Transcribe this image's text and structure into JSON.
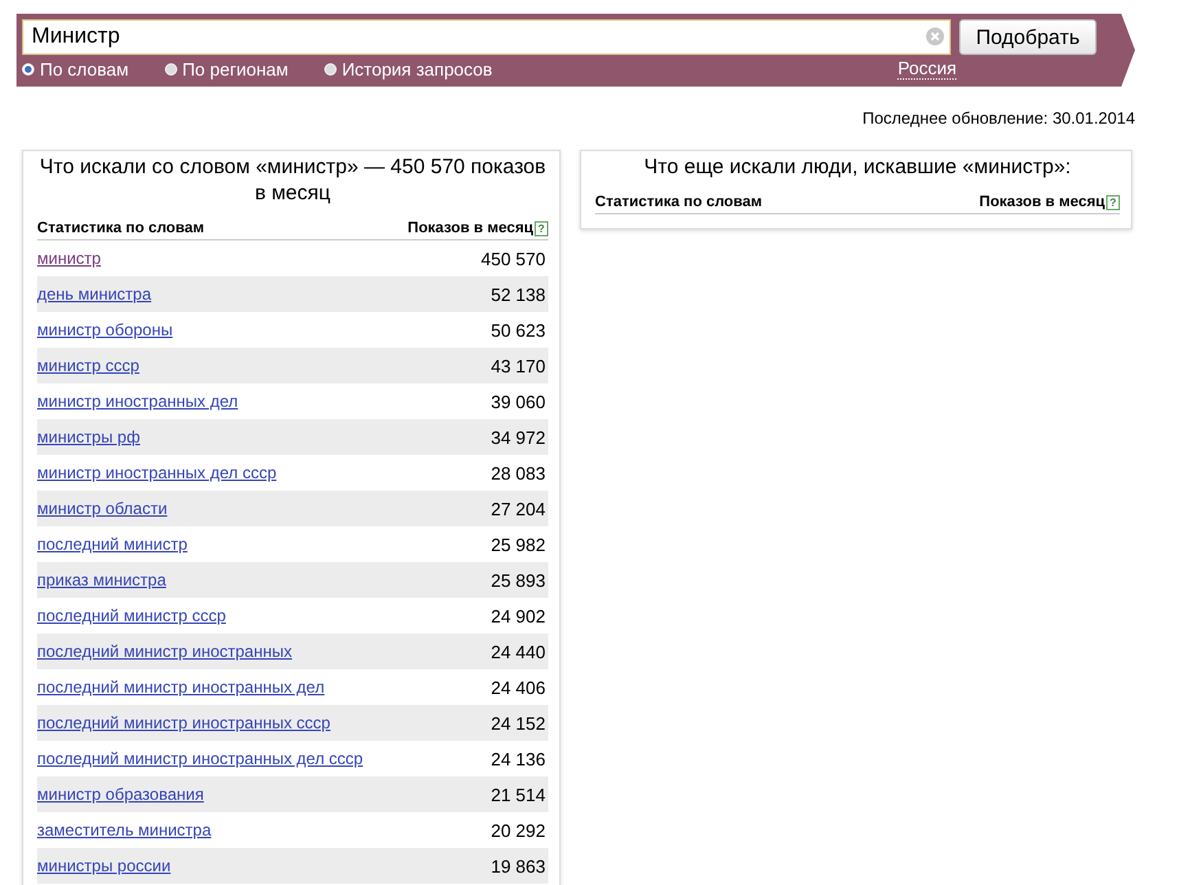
{
  "search": {
    "value": "Министр",
    "button": "Подобрать",
    "modes": [
      {
        "label": "По словам",
        "selected": true
      },
      {
        "label": "По регионам",
        "selected": false
      },
      {
        "label": "История запросов",
        "selected": false
      }
    ],
    "region": "Россия"
  },
  "last_update": "Последнее обновление: 30.01.2014",
  "main_panel": {
    "title": "Что искали со словом «министр» — 450 570 показов в месяц",
    "columns": [
      "Статистика по словам",
      "Показов в месяц"
    ],
    "help": "?",
    "rows": [
      {
        "phrase": "министр",
        "count": "450 570",
        "visited": true
      },
      {
        "phrase": "день министра",
        "count": "52 138",
        "visited": false
      },
      {
        "phrase": "министр обороны",
        "count": "50 623",
        "visited": false
      },
      {
        "phrase": "министр ссср",
        "count": "43 170",
        "visited": false
      },
      {
        "phrase": "министр иностранных дел",
        "count": "39 060",
        "visited": false
      },
      {
        "phrase": "министры рф",
        "count": "34 972",
        "visited": false
      },
      {
        "phrase": "министр иностранных дел ссср",
        "count": "28 083",
        "visited": false
      },
      {
        "phrase": "министр области",
        "count": "27 204",
        "visited": false
      },
      {
        "phrase": "последний министр",
        "count": "25 982",
        "visited": false
      },
      {
        "phrase": "приказ министра",
        "count": "25 893",
        "visited": false
      },
      {
        "phrase": "последний министр ссср",
        "count": "24 902",
        "visited": false
      },
      {
        "phrase": "последний министр иностранных",
        "count": "24 440",
        "visited": false
      },
      {
        "phrase": "последний министр иностранных дел",
        "count": "24 406",
        "visited": false
      },
      {
        "phrase": "последний министр иностранных ссср",
        "count": "24 152",
        "visited": false
      },
      {
        "phrase": "последний министр иностранных дел ссср",
        "count": "24 136",
        "visited": false
      },
      {
        "phrase": "министр образования",
        "count": "21 514",
        "visited": false
      },
      {
        "phrase": "заместитель министра",
        "count": "20 292",
        "visited": false
      },
      {
        "phrase": "министры россии",
        "count": "19 863",
        "visited": false
      }
    ]
  },
  "side_panel": {
    "title": "Что еще искали люди, искавшие «министр»:",
    "columns": [
      "Статистика по словам",
      "Показов в месяц"
    ],
    "help": "?"
  }
}
